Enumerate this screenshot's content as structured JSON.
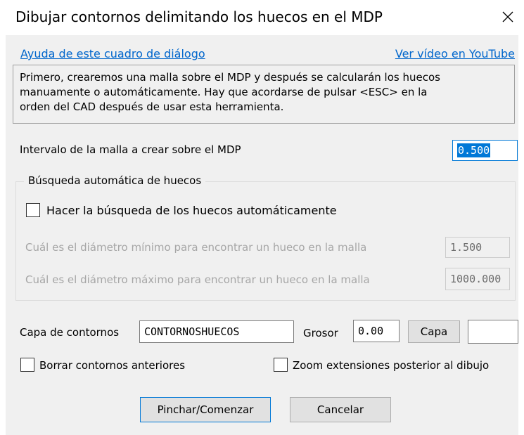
{
  "window": {
    "title": "Dibujar contornos delimitando los huecos en el MDP",
    "close_icon": "close-icon"
  },
  "links": {
    "help": "Ayuda de este cuadro de diálogo",
    "video": "Ver vídeo en YouTube"
  },
  "info": {
    "lines": [
      "Primero, crearemos una malla sobre el MDP y después se calcularán los huecos",
      "manuamente o automáticamente. Hay que acordarse de pulsar <ESC> en la",
      "orden del CAD después de usar esta herramienta."
    ]
  },
  "mesh": {
    "label": "Intervalo de la malla a crear sobre el MDP",
    "value": "0.500"
  },
  "auto_search": {
    "group_title": "Búsqueda automática de huecos",
    "checkbox_label": "Hacer la búsqueda de los huecos automáticamente",
    "checked": false,
    "min_label": "Cuál es el diámetro mínimo para encontrar un hueco en la malla",
    "min_value": "1.500",
    "max_label": "Cuál es el diámetro máximo para encontrar un hueco en la malla",
    "max_value": "1000.000"
  },
  "layer": {
    "label": "Capa de contornos",
    "value": "CONTORNOSHUECOS",
    "thickness_label": "Grosor",
    "thickness_value": "0.00",
    "layer_button": "Capa",
    "color_value": ""
  },
  "options": {
    "delete_previous": "Borrar contornos anteriores",
    "zoom_extents": "Zoom extensiones posterior al dibujo"
  },
  "buttons": {
    "start": "Pinchar/Comenzar",
    "cancel": "Cancelar"
  },
  "colors": {
    "link": "#0066cc",
    "selection": "#0078d7",
    "dialog_bg": "#f0f0f0",
    "disabled_text": "#a6a6a6"
  }
}
